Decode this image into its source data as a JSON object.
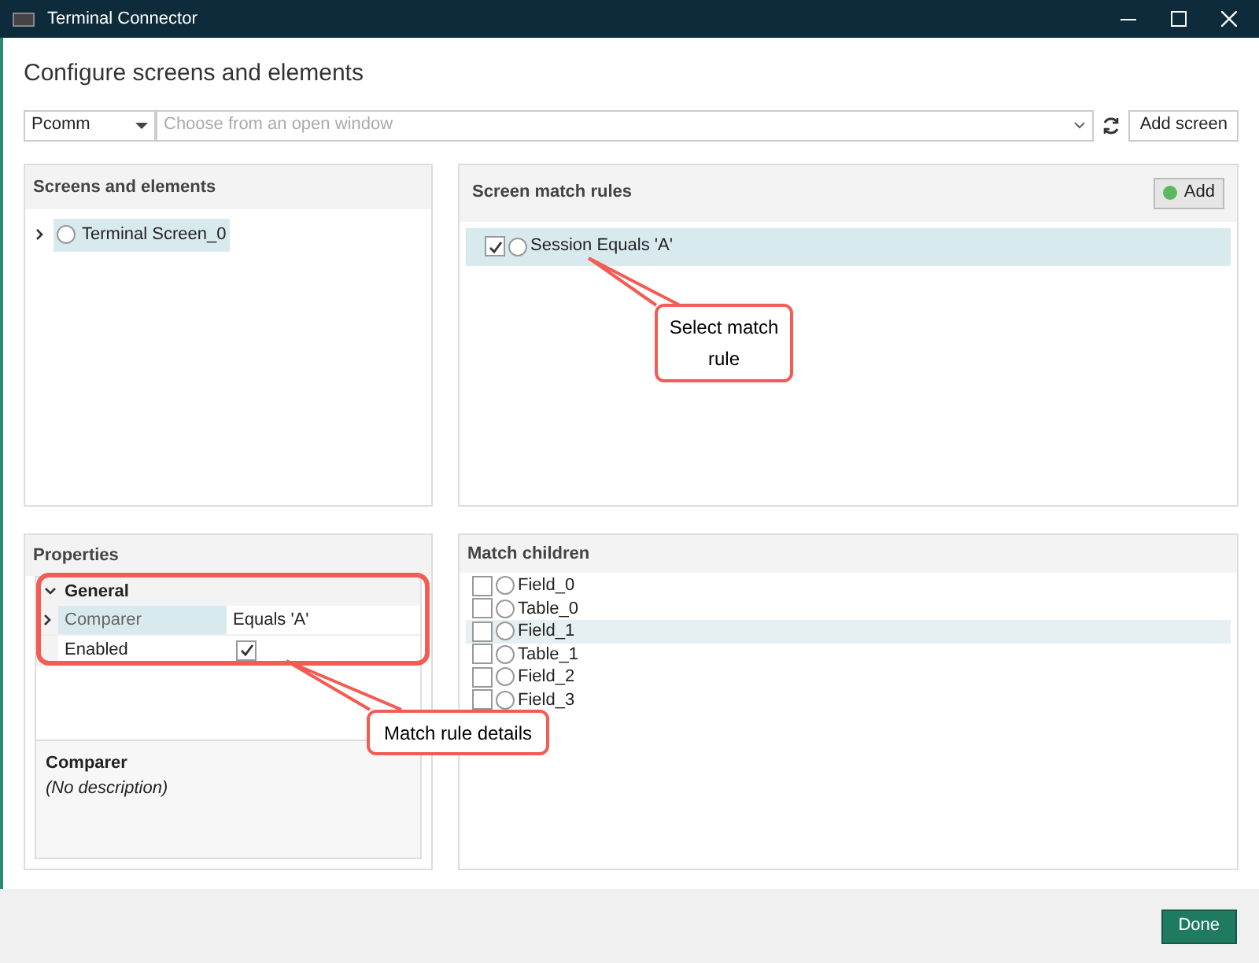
{
  "window": {
    "title": "Terminal Connector"
  },
  "heading": "Configure screens and elements",
  "toolbar": {
    "provider": "Pcomm",
    "window_field": {
      "placeholder": "Choose from an open window"
    },
    "add_screen": "Add screen"
  },
  "screens_panel": {
    "title": "Screens and elements",
    "items": [
      {
        "label": "Terminal Screen_0",
        "selected": true,
        "expanded": false
      }
    ]
  },
  "rules_panel": {
    "title": "Screen match rules",
    "add": "Add",
    "rules": [
      {
        "label": "Session Equals 'A'",
        "checked": true,
        "selected": true
      }
    ]
  },
  "properties_panel": {
    "title": "Properties",
    "category": "General",
    "rows": [
      {
        "name": "Comparer",
        "value": "Equals 'A'",
        "kind": "text",
        "selected": true
      },
      {
        "name": "Enabled",
        "kind": "checkbox",
        "checked": true,
        "selected": false
      }
    ],
    "description_title": "Comparer",
    "description": "(No description)"
  },
  "children_panel": {
    "title": "Match children",
    "items": [
      {
        "label": "Field_0",
        "checked": false,
        "selected": false
      },
      {
        "label": "Table_0",
        "checked": false,
        "selected": false
      },
      {
        "label": "Field_1",
        "checked": false,
        "selected": true
      },
      {
        "label": "Table_1",
        "checked": false,
        "selected": false
      },
      {
        "label": "Field_2",
        "checked": false,
        "selected": false
      },
      {
        "label": "Field_3",
        "checked": false,
        "selected": false
      }
    ]
  },
  "callouts": [
    {
      "text": "Select match rule"
    },
    {
      "text": "Match rule details"
    }
  ],
  "footer": {
    "done": "Done"
  }
}
